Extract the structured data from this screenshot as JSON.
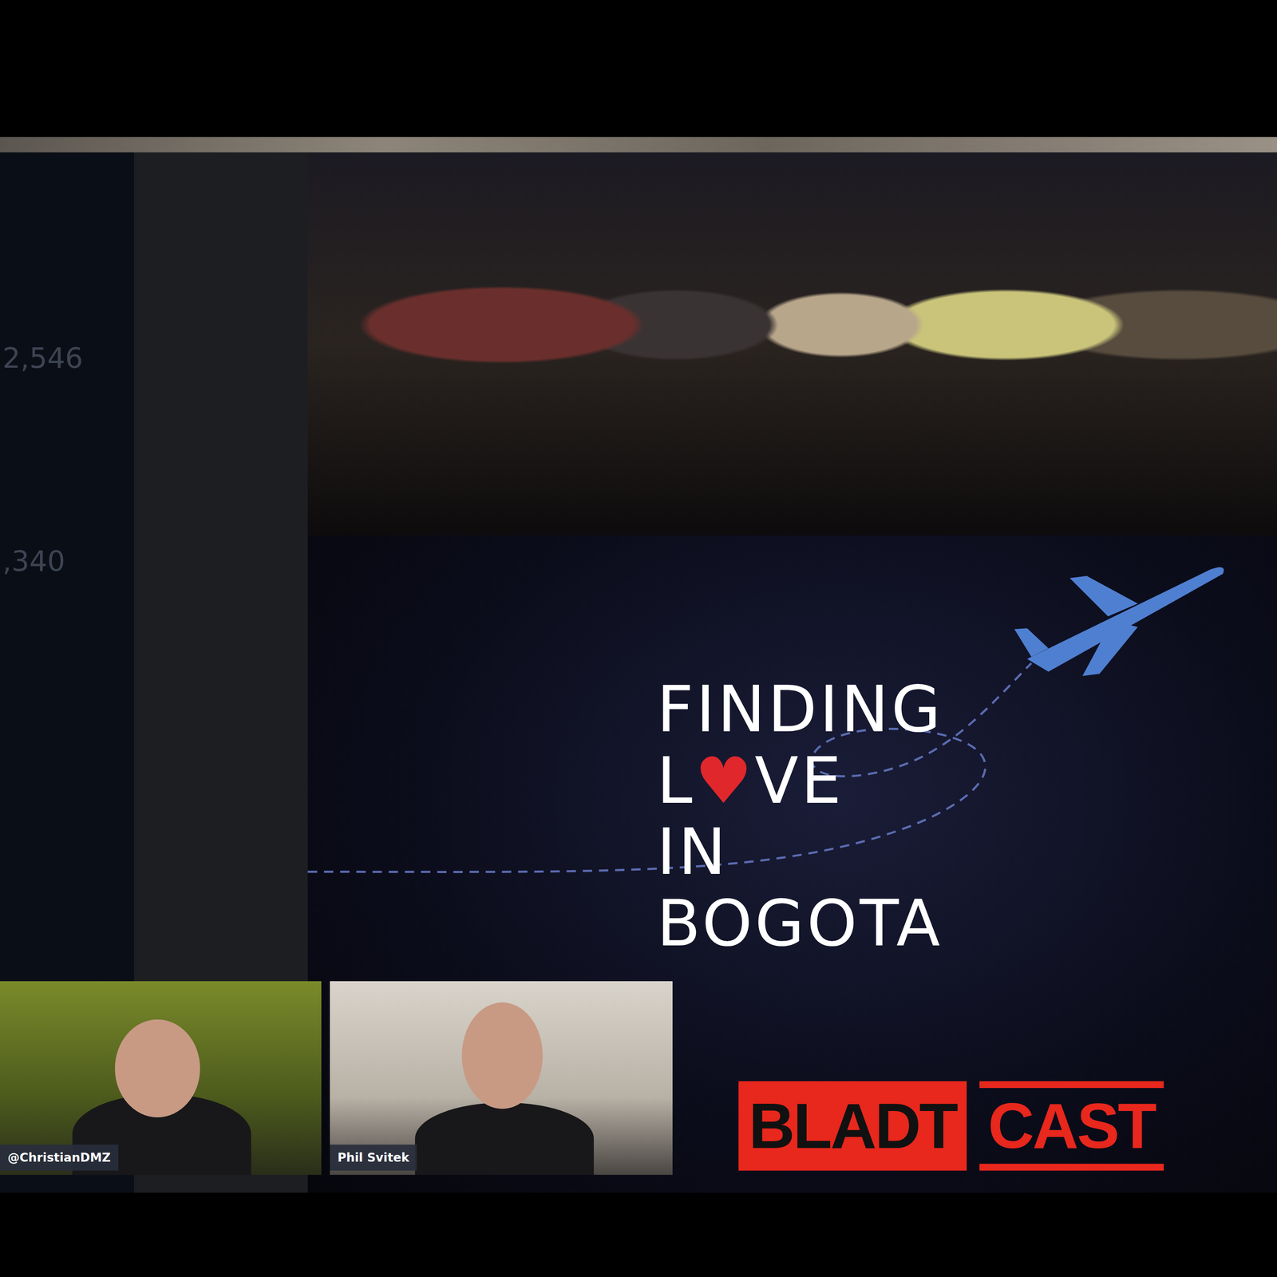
{
  "stats": [
    "2,546",
    ",340"
  ],
  "poster": {
    "title_lines": [
      "FINDING",
      "L♥VE",
      "IN",
      "BOGOTA"
    ]
  },
  "participants": [
    {
      "name": "@ChristianDMZ"
    },
    {
      "name": "Phil Svitek"
    }
  ],
  "logo": {
    "left": "BLADT",
    "right": "CAST"
  }
}
